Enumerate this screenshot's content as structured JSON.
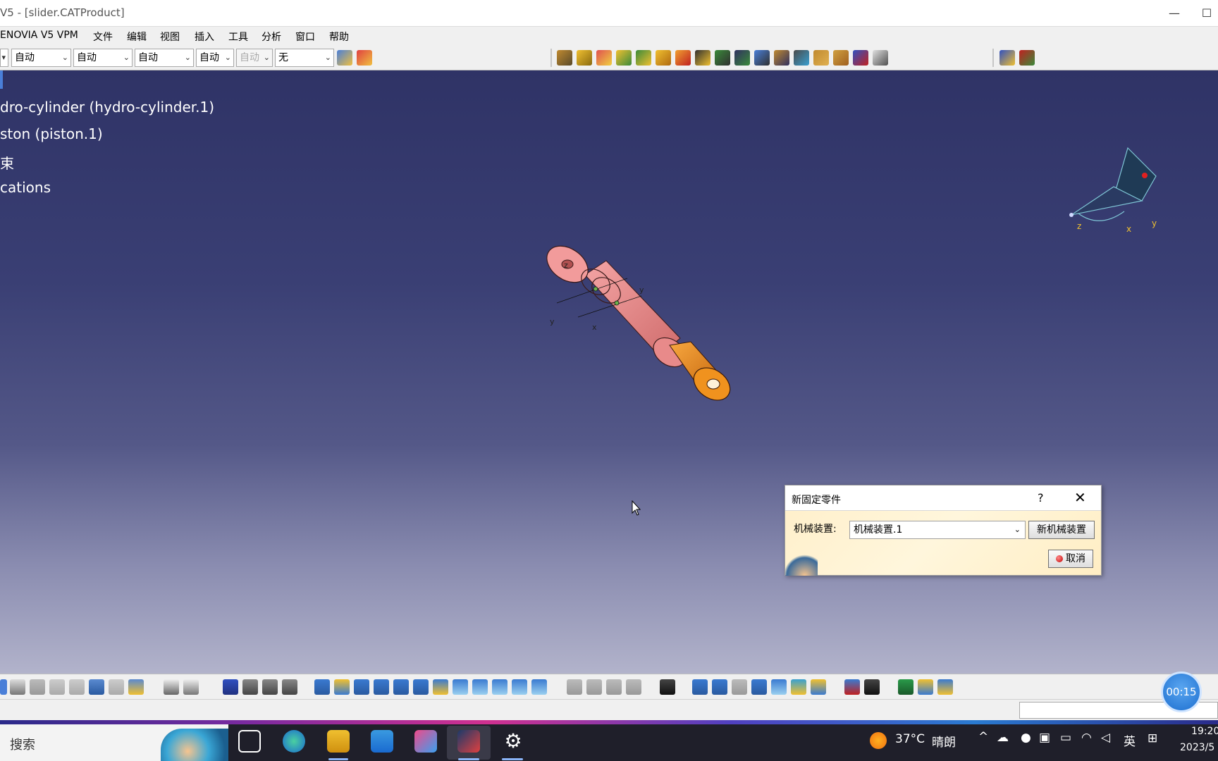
{
  "window": {
    "title": "V5 - [slider.CATProduct]",
    "min_glyph": "—",
    "max_glyph": "☐"
  },
  "menu": {
    "items": [
      "ENOVIA V5 VPM",
      "文件",
      "编辑",
      "视图",
      "插入",
      "工具",
      "分析",
      "窗口",
      "帮助"
    ]
  },
  "toolbar": {
    "combos": [
      {
        "value": "自动",
        "disabled": false
      },
      {
        "value": "自动",
        "disabled": false
      },
      {
        "value": "自动",
        "disabled": false
      },
      {
        "value": "自动",
        "disabled": false
      },
      {
        "value": "自动",
        "disabled": true
      },
      {
        "value": "无",
        "disabled": false
      }
    ]
  },
  "tree": {
    "items": [
      "dro-cylinder (hydro-cylinder.1)",
      "ston (piston.1)",
      "束",
      "cations"
    ]
  },
  "compass": {
    "x_label": "x",
    "y_label": "y",
    "z_label": "z"
  },
  "axis_labels": {
    "z": "z",
    "y1": "y",
    "y2": "y",
    "x": "x"
  },
  "dialog": {
    "title": "新固定零件",
    "help": "?",
    "close": "✕",
    "label": "机械装置:",
    "selected_value": "机械装置.1",
    "new_button": "新机械装置",
    "cancel_button": "取消"
  },
  "timer": {
    "value": "00:15"
  },
  "taskbar": {
    "search_placeholder": "搜索",
    "weather_temp": "37°C",
    "weather_desc": "晴朗",
    "ime": "英",
    "time": "19:20",
    "date": "2023/5"
  },
  "colors": {
    "viewport_top": "#2f3366",
    "viewport_bottom": "#b2b3cb",
    "cylinder_body": "#f08d8d",
    "rod_end": "#f0921e",
    "dialog_bg": "#fff3d6"
  }
}
